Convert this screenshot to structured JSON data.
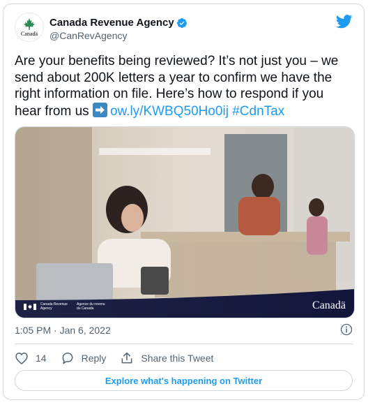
{
  "author": {
    "display_name": "Canada Revenue Agency",
    "handle": "@CanRevAgency",
    "avatar_wordmark": "Canadä",
    "verified": true
  },
  "tweet": {
    "text": "Are your benefits being reviewed? It’s not just you – we send about 200K letters a year to confirm we have the right information on file. Here’s how to respond if you hear from us",
    "link": "ow.ly/KWBQ50Ho0ij",
    "hashtag": "#CdnTax",
    "emoji": "right-arrow-emoji"
  },
  "media": {
    "agency_en": "Canada Revenue Agency",
    "agency_fr": "Agence du revenu du Canada",
    "wordmark": "Canadä"
  },
  "meta": {
    "timestamp": "1:05 PM · Jan 6, 2022"
  },
  "actions": {
    "like_count": "14",
    "reply_label": "Reply",
    "share_label": "Share this Tweet"
  },
  "explore_label": "Explore what's happening on Twitter",
  "icons": {
    "bird": "twitter-bird-icon",
    "verified": "verified-badge-icon",
    "info": "info-icon",
    "heart": "heart-icon",
    "reply": "reply-icon",
    "share": "share-icon"
  },
  "colors": {
    "accent": "#1d9bf0",
    "text": "#0f1419",
    "muted": "#536471",
    "border": "#cfd9de"
  }
}
